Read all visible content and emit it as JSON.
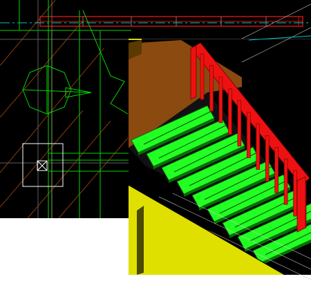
{
  "screen": {
    "description_free": true
  },
  "colors": {
    "cad_background": "#000000",
    "cad_outline": "#00d800",
    "cad_handrail_plan": "#d01010",
    "cad_centerline": "#00c8c8",
    "cad_hatch": "#8a3a10",
    "cad_gray": "#909090",
    "render_handrail": "#ee1111",
    "render_treads": "#22ff22",
    "render_landing": "#8a4a10",
    "render_wall": "#e0e000",
    "render_wall_edge": "#4a4a00"
  },
  "icons": {
    "column_marker": "boxed-x-icon",
    "north_arrow": "octagon-arrow-icon"
  }
}
